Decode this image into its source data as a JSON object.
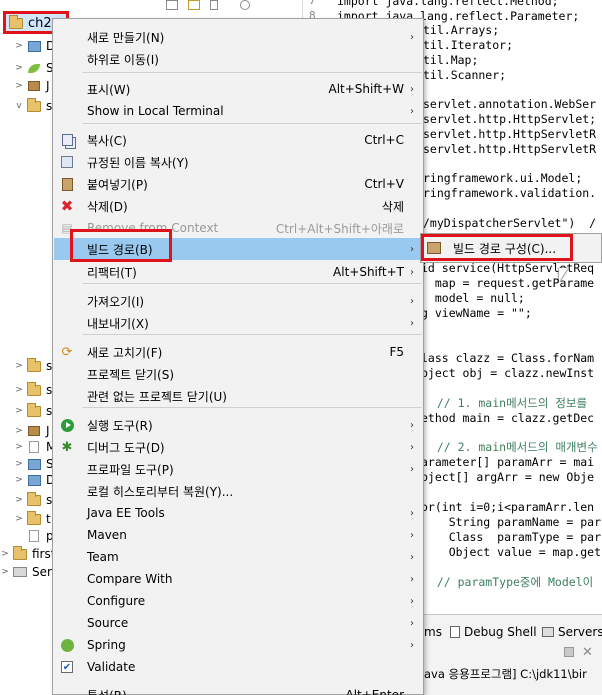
{
  "explorer": {
    "selected_project": "ch2",
    "rows": [
      {
        "label": "D",
        "arrow": ">"
      },
      {
        "label": "S",
        "arrow": ">"
      },
      {
        "label": "J",
        "arrow": ">"
      },
      {
        "label": "s",
        "arrow": "v"
      },
      {
        "label": "s",
        "arrow": ">"
      },
      {
        "label": "s",
        "arrow": ">"
      },
      {
        "label": "s",
        "arrow": ">"
      },
      {
        "label": "J",
        "arrow": ">"
      },
      {
        "label": "M",
        "arrow": ">"
      },
      {
        "label": "S",
        "arrow": ">"
      },
      {
        "label": "D",
        "arrow": ">"
      },
      {
        "label": "s",
        "arrow": ">"
      },
      {
        "label": "t",
        "arrow": ">"
      },
      {
        "label": "p",
        "arrow": ""
      },
      {
        "label": "first",
        "arrow": ">"
      },
      {
        "label": "Serv",
        "arrow": ">"
      }
    ]
  },
  "editor": {
    "line_numbers": [
      "7",
      "8"
    ],
    "lines": [
      "import java.lang.reflect.Method;",
      "import java.lang.reflect.Parameter;",
      "til.Arrays;",
      "til.Iterator;",
      "til.Map;",
      "til.Scanner;",
      "servlet.annotation.WebSer",
      "servlet.http.HttpServlet;",
      "servlet.http.HttpServletR",
      "servlet.http.HttpServletR",
      "ringframework.ui.Model;",
      "ringframework.validation.",
      "/myDispatcherServlet\")  /",
      "id service(HttpServletReq",
      "  map = request.getParame",
      "  model = null;",
      "g viewName = \"\";",
      "lass clazz = Class.forNam",
      "bject obj = clazz.newInst",
      "  // 1. main메서드의 정보를",
      "ethod main = clazz.getDec",
      "  // 2. main메서드의 매개변수",
      "arameter[] paramArr = mai",
      "bject[] argArr = new Obje",
      "or(int i=0;i<paramArr.len",
      "    String paramName = par",
      "    Class  paramType = par",
      "    Object value = map.get",
      "  // paramType중에 Model이"
    ]
  },
  "bottom_panel": {
    "tab_partial": "ms",
    "tab_debug_shell": "Debug Shell",
    "tab_servers": "Servers",
    "console_text": "ava 응용프로그램] C:\\jdk11\\bir"
  },
  "context_menu": {
    "items": [
      {
        "label": "새로 만들기(N)",
        "shortcut": "",
        "submenu": true
      },
      {
        "label": "하위로 이동(I)",
        "shortcut": "",
        "submenu": false
      },
      {
        "label": "표시(W)",
        "shortcut": "Alt+Shift+W",
        "submenu": true
      },
      {
        "label": "Show in Local Terminal",
        "shortcut": "",
        "submenu": true
      },
      {
        "label": "복사(C)",
        "shortcut": "Ctrl+C",
        "submenu": false,
        "icon": "copy-icon"
      },
      {
        "label": "규정된 이름 복사(Y)",
        "shortcut": "",
        "submenu": false,
        "icon": "copy-qualified-icon"
      },
      {
        "label": "붙여넣기(P)",
        "shortcut": "Ctrl+V",
        "submenu": false,
        "icon": "paste-icon"
      },
      {
        "label": "삭제(D)",
        "shortcut": "삭제",
        "submenu": false,
        "icon": "delete-icon"
      },
      {
        "label": "Remove from Context",
        "shortcut": "Ctrl+Alt+Shift+아래로",
        "submenu": false,
        "disabled": true,
        "icon": "remove-context-icon"
      },
      {
        "label": "빌드 경로(B)",
        "shortcut": "",
        "submenu": true,
        "highlighted": true
      },
      {
        "label": "리팩터(T)",
        "shortcut": "Alt+Shift+T",
        "submenu": true
      },
      {
        "label": "가져오기(I)",
        "shortcut": "",
        "submenu": true
      },
      {
        "label": "내보내기(X)",
        "shortcut": "",
        "submenu": true
      },
      {
        "label": "새로 고치기(F)",
        "shortcut": "F5",
        "submenu": false,
        "icon": "refresh-icon"
      },
      {
        "label": "프로젝트 닫기(S)",
        "shortcut": "",
        "submenu": false
      },
      {
        "label": "관련 없는 프로젝트 닫기(U)",
        "shortcut": "",
        "submenu": false
      },
      {
        "label": "실행 도구(R)",
        "shortcut": "",
        "submenu": true,
        "icon": "run-icon"
      },
      {
        "label": "디버그 도구(D)",
        "shortcut": "",
        "submenu": true,
        "icon": "debug-icon"
      },
      {
        "label": "프로파일 도구(P)",
        "shortcut": "",
        "submenu": true
      },
      {
        "label": "로컬 히스토리부터 복원(Y)...",
        "shortcut": "",
        "submenu": false
      },
      {
        "label": "Java EE Tools",
        "shortcut": "",
        "submenu": true
      },
      {
        "label": "Maven",
        "shortcut": "",
        "submenu": true
      },
      {
        "label": "Team",
        "shortcut": "",
        "submenu": true
      },
      {
        "label": "Compare With",
        "shortcut": "",
        "submenu": true
      },
      {
        "label": "Configure",
        "shortcut": "",
        "submenu": true
      },
      {
        "label": "Source",
        "shortcut": "",
        "submenu": true
      },
      {
        "label": "Spring",
        "shortcut": "",
        "submenu": true,
        "icon": "spring-icon"
      },
      {
        "label": "Validate",
        "shortcut": "",
        "submenu": false,
        "icon": "validate-checkbox-icon"
      },
      {
        "label": "특성(R)",
        "shortcut": "Alt+Enter",
        "submenu": false
      }
    ],
    "submenu_arrow": "›"
  },
  "submenu": {
    "item_label": "빌드 경로 구성(C)..."
  },
  "colors": {
    "highlight": "#99c9ef",
    "annotation_red": "#e0121b",
    "keyword": "#7f0055",
    "string": "#2a00ff",
    "comment": "#3f7f5f"
  }
}
